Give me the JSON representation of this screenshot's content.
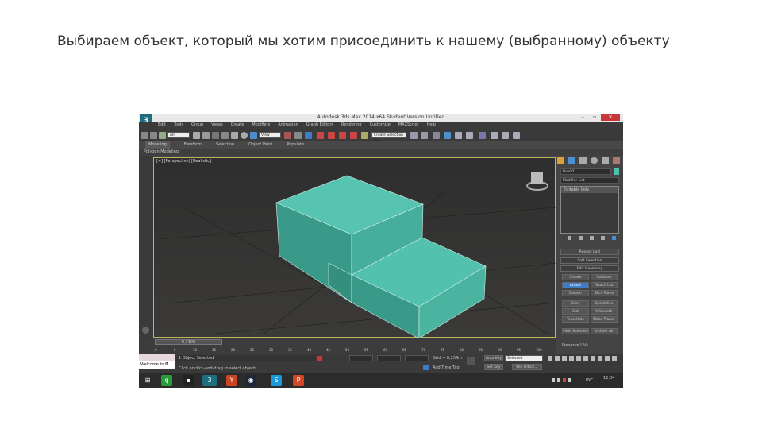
{
  "slide": {
    "caption": "Выбираем объект, который мы хотим присоединить к нашему (выбранному) объекту"
  },
  "app": {
    "title": "Autodesk 3ds Max 2014 x64    Student Version    Untitled",
    "menu": [
      "Edit",
      "Tools",
      "Group",
      "Views",
      "Create",
      "Modifiers",
      "Animation",
      "Graph Editors",
      "Rendering",
      "Customize",
      "MAXScript",
      "Help"
    ],
    "toolbar": {
      "selection_filter": "All",
      "ref_coord": "View",
      "named_selection": "Create Selection Se"
    },
    "ribbon_tabs": [
      "Modeling",
      "Freeform",
      "Selection",
      "Object Paint",
      "Populate"
    ],
    "ribbon_panel": "Polygon Modeling",
    "viewport_label": "[+] [Perspective] [Realistic]",
    "object_color": "#4fc0ad",
    "command_panel": {
      "object_name": "Box001",
      "modifier_list": "Modifier List",
      "stack_item": "Editable Poly",
      "rollouts": [
        "Soft Selection",
        "Edit Geometry"
      ],
      "buttons": [
        "Repeat Last",
        "Constraints",
        "Create",
        "Collapse",
        "Attach",
        "Attach List",
        "Detach",
        "Slice Plane",
        "Slice",
        "QuickSlice",
        "Cut",
        "MSmooth",
        "Tessellate",
        "Make Planar",
        "Hide Selected",
        "Unhide All"
      ],
      "active_button": "Attach",
      "checkbox": "Preserve UVs"
    },
    "timeline": {
      "frame": "0 / 100",
      "ticks": [
        "0",
        "5",
        "10",
        "15",
        "20",
        "25",
        "30",
        "35",
        "40",
        "45",
        "50",
        "55",
        "60",
        "65",
        "70",
        "75",
        "80",
        "85",
        "90",
        "95",
        "100"
      ]
    },
    "status": {
      "maxscript": "Welcome to M",
      "selection": "1 Object Selected",
      "prompt": "Click or click-and-drag to select objects",
      "grid": "Grid = 0,254m",
      "add_time_tag": "Add Time Tag",
      "auto_key": "Auto Key",
      "selected": "Selected",
      "set_key": "Set Key",
      "key_filters": "Key Filters..."
    },
    "taskbar": {
      "lang": "РУС",
      "time": "12:04"
    }
  }
}
